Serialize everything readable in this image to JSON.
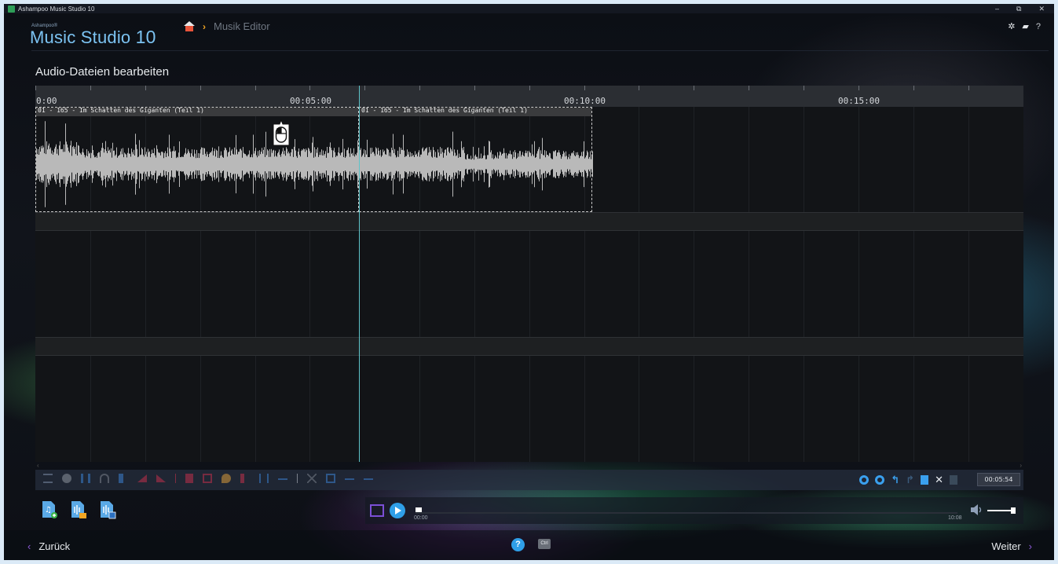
{
  "window": {
    "title": "Ashampoo Music Studio 10",
    "controls": [
      "–",
      "⧉",
      "✕"
    ]
  },
  "header": {
    "brand_small": "Ashampoo®",
    "brand": "Music Studio",
    "brand_version": "10",
    "breadcrumb": {
      "home_icon": "home-icon",
      "current": "Musik Editor"
    },
    "icons": [
      "gear-icon",
      "message-icon",
      "help-icon"
    ],
    "help_glyph": "?"
  },
  "editor": {
    "section_title": "Audio-Dateien bearbeiten",
    "ruler_labels": [
      "0:00",
      "00:05:00",
      "00:10:00",
      "00:15:00"
    ],
    "clips": [
      {
        "name": "01 - 165 - Im Schatten des Giganten (Teil 1)"
      },
      {
        "name": "01 - 165 - Im Schatten des Giganten (Teil 1)"
      }
    ],
    "cursor_icon": "mouse-icon",
    "playhead_color": "#5ec4c9",
    "waveform_color": "#b9b9b9"
  },
  "toolbar": {
    "left_icons": [
      "settings-icon",
      "record-icon",
      "split-icon",
      "headphones-icon",
      "rewind-icon",
      "fade-in-icon",
      "fade-out-icon",
      "separator",
      "delete-icon",
      "trim-icon",
      "effect-icon",
      "mute-icon",
      "normalize-icon",
      "move-icon",
      "cursor-icon",
      "cut-icon",
      "marker-icon",
      "move-right-icon",
      "move-left-icon"
    ],
    "right_icons": [
      "zoom-in-icon",
      "zoom-out-icon",
      "undo-icon",
      "redo-icon",
      "copy-icon",
      "cut-icon",
      "paste-icon"
    ],
    "time": "00:05:54"
  },
  "player": {
    "file_icons": [
      "add-music-icon",
      "export-audio-icon",
      "save-audio-icon"
    ],
    "time_start": "00:00",
    "time_end": "10:08",
    "volume_icon": "volume-icon"
  },
  "footer": {
    "back_label": "Zurück",
    "next_label": "Weiter",
    "help_label": "?",
    "ctrl_label": "Ctrl"
  },
  "colors": {
    "accent": "#7cc3f2",
    "purple": "#8d5ad8",
    "blue_button": "#2f9fe8",
    "toolbar_icons": "#3a7fd0"
  }
}
